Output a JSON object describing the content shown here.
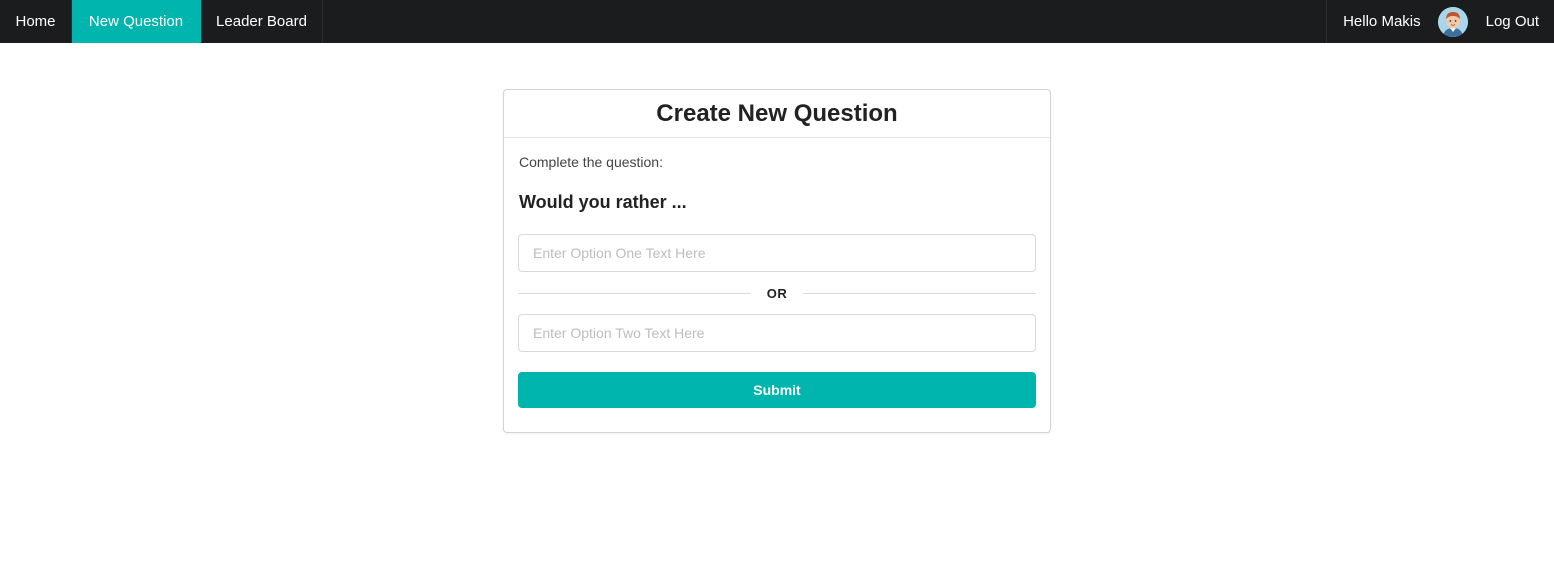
{
  "nav": {
    "items": [
      {
        "label": "Home",
        "active": false
      },
      {
        "label": "New Question",
        "active": true
      },
      {
        "label": "Leader Board",
        "active": false
      }
    ],
    "greeting": "Hello Makis",
    "avatar_icon": "user-avatar",
    "logout_label": "Log Out"
  },
  "card": {
    "title": "Create New Question",
    "prompt": "Complete the question:",
    "would_you_rather": "Would you rather ...",
    "option_one": {
      "value": "",
      "placeholder": "Enter Option One Text Here"
    },
    "divider_label": "OR",
    "option_two": {
      "value": "",
      "placeholder": "Enter Option Two Text Here"
    },
    "submit_label": "Submit"
  },
  "colors": {
    "navbar_bg": "#1b1c1d",
    "accent": "#00b5ad"
  }
}
